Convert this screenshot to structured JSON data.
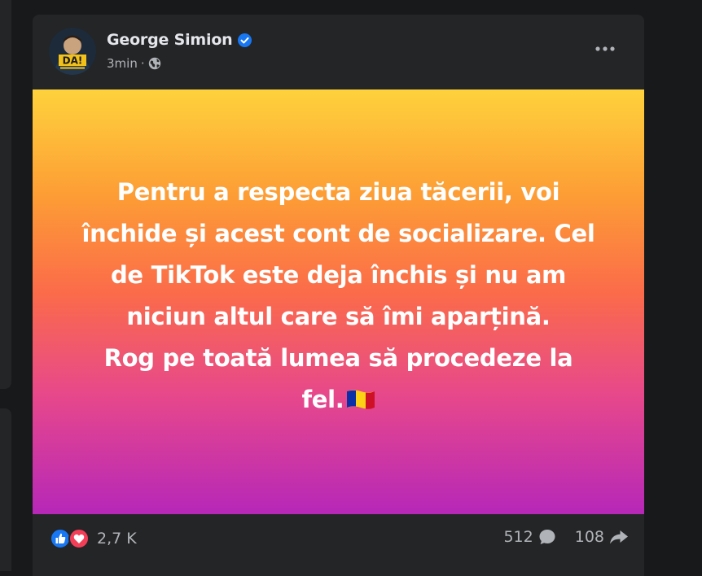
{
  "post": {
    "author": "George Simion",
    "time": "3min",
    "separator": "·",
    "avatar_badge": "DA!",
    "icons": {
      "verified": "verified-badge-icon",
      "audience": "globe-icon",
      "more": "more-horizontal-icon",
      "like": "like-reaction-icon",
      "love": "love-reaction-icon",
      "comment": "comment-icon",
      "share": "share-icon",
      "flag": "romania-flag-icon"
    },
    "text_lines": [
      "Pentru a respecta ziua tăcerii, voi",
      "închide și acest cont de socializare. Cel",
      "de TikTok este deja închis și nu am",
      "niciun altul care să îmi aparțină.",
      "Rog pe toată lumea să procedeze la",
      "fel."
    ],
    "colors": {
      "gradient_top": "#fed23c",
      "gradient_bottom": "#b627b8",
      "card": "#242526",
      "verified": "#1877f2"
    }
  },
  "footer": {
    "reaction_count": "2,7 K",
    "comment_count": "512",
    "share_count": "108"
  }
}
